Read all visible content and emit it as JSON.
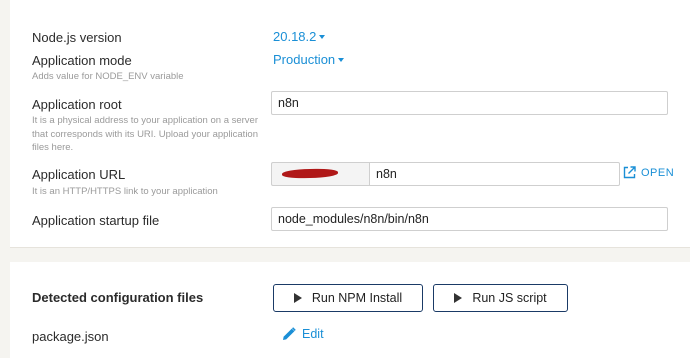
{
  "settings": {
    "nodejs_version": {
      "label": "Node.js version",
      "value": "20.18.2"
    },
    "application_mode": {
      "label": "Application mode",
      "value": "Production",
      "hint": "Adds value for NODE_ENV variable"
    },
    "application_root": {
      "label": "Application root",
      "value": "n8n",
      "hint_lines": [
        "It is a physical address to your application on a server",
        "that corresponds with its URI. Upload your application",
        "files here."
      ]
    },
    "application_url": {
      "label": "Application URL",
      "value": "n8n",
      "hint": "It is an HTTP/HTTPS link to your application",
      "open_label": "OPEN"
    },
    "startup_file": {
      "label": "Application startup file",
      "value": "node_modules/n8n/bin/n8n"
    }
  },
  "config": {
    "heading": "Detected configuration files",
    "run_npm_label": "Run NPM Install",
    "run_js_label": "Run JS script",
    "files": [
      {
        "name": "package.json",
        "edit_label": "Edit"
      }
    ]
  },
  "colors": {
    "accent": "#1a8fd6",
    "button_border": "#1a3a66",
    "redaction": "#b01818"
  }
}
